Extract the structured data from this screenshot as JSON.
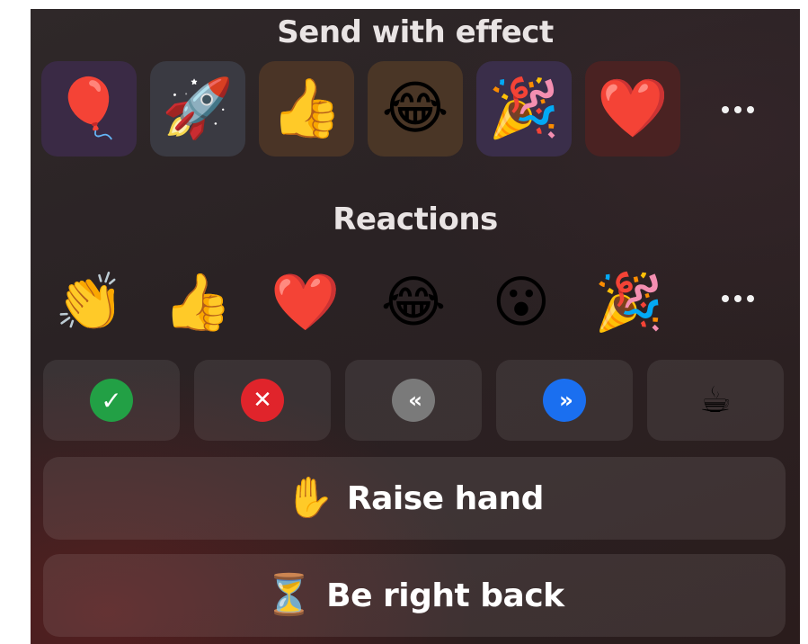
{
  "effects": {
    "title": "Send with effect",
    "items": [
      {
        "emoji": "🎈",
        "name": "balloon",
        "tile_color": "#3a2a45"
      },
      {
        "emoji": "🚀",
        "name": "rocket",
        "tile_color": "#3a3a42"
      },
      {
        "emoji": "👍",
        "name": "thumbs-up",
        "tile_color": "#4a3426"
      },
      {
        "emoji": "😂",
        "name": "tears-of-joy",
        "tile_color": "#4a3626"
      },
      {
        "emoji": "🎉",
        "name": "party-popper",
        "tile_color": "#3a2e4a"
      },
      {
        "emoji": "❤️",
        "name": "heart",
        "tile_color": "#4a2222"
      }
    ],
    "more_icon": "more-icon"
  },
  "reactions": {
    "title": "Reactions",
    "items": [
      {
        "emoji": "👏",
        "name": "clapping-hands"
      },
      {
        "emoji": "👍",
        "name": "thumbs-up"
      },
      {
        "emoji": "❤️",
        "name": "heart"
      },
      {
        "emoji": "😂",
        "name": "tears-of-joy"
      },
      {
        "emoji": "😮",
        "name": "surprised-face"
      },
      {
        "emoji": "🎉",
        "name": "party-popper"
      }
    ],
    "more_icon": "more-icon"
  },
  "status_buttons": [
    {
      "name": "yes",
      "symbol": "✓",
      "color": "#22a045",
      "icon": "check-icon"
    },
    {
      "name": "no",
      "symbol": "✕",
      "color": "#e0242b",
      "icon": "x-icon"
    },
    {
      "name": "slower",
      "symbol": "‹‹",
      "color": "#7a7a7a",
      "icon": "rewind-icon"
    },
    {
      "name": "faster",
      "symbol": "››",
      "color": "#1a6ff0",
      "icon": "fast-forward-icon"
    },
    {
      "name": "coffee-break",
      "symbol": "☕",
      "color": "transparent",
      "icon": "coffee-icon"
    }
  ],
  "raise_hand": {
    "emoji": "✋",
    "label": "Raise hand"
  },
  "be_right_back": {
    "emoji": "⏳",
    "label": "Be right back"
  }
}
